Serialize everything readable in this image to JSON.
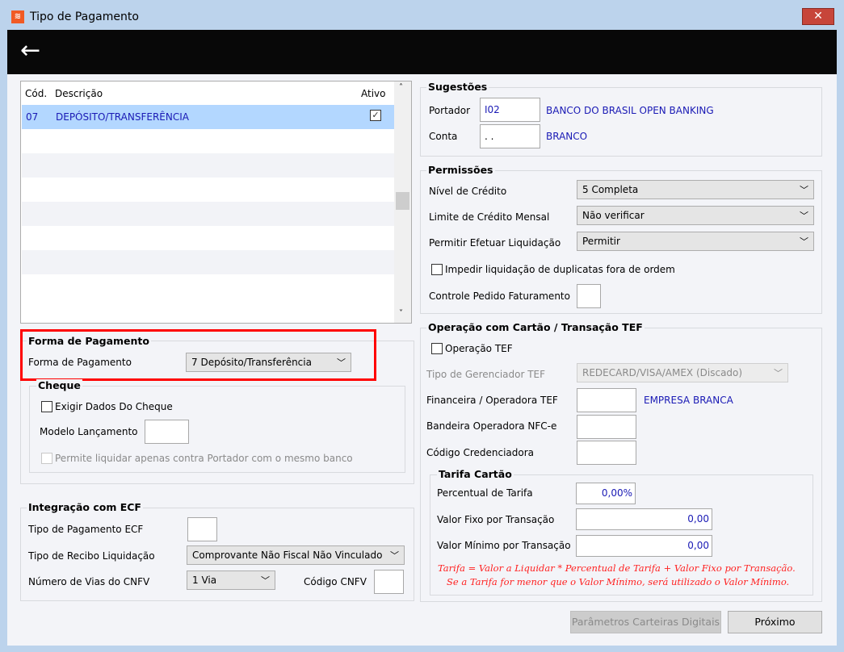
{
  "window": {
    "title": "Tipo de Pagamento",
    "close": "✕"
  },
  "grid": {
    "headers": [
      "Cód.",
      "Descrição",
      "Ativo"
    ],
    "rows": [
      {
        "cod": "07",
        "descricao": "DEPÓSITO/TRANSFERÊNCIA",
        "ativo": true
      }
    ]
  },
  "forma": {
    "group": "Forma de Pagamento",
    "label": "Forma de Pagamento",
    "value": "7 Depósito/Transferência"
  },
  "cheque": {
    "group": "Cheque",
    "exigir": "Exigir Dados Do Cheque",
    "modelo": "Modelo Lançamento",
    "permite": "Permite liquidar apenas contra Portador com o mesmo banco"
  },
  "ecf": {
    "group": "Integração com ECF",
    "tipo_pag": "Tipo de Pagamento ECF",
    "tipo_recibo": "Tipo de Recibo Liquidação",
    "tipo_recibo_value": "Comprovante Não Fiscal Não Vinculado",
    "vias": "Número de Vias do CNFV",
    "vias_value": "1 Via",
    "codigo": "Código CNFV"
  },
  "sugestoes": {
    "group": "Sugestões",
    "portador": "Portador",
    "portador_value": "I02",
    "portador_name": "BANCO DO BRASIL OPEN BANKING",
    "conta": "Conta",
    "conta_value": ". .",
    "conta_name": "BRANCO"
  },
  "permissoes": {
    "group": "Permissões",
    "nivel": "Nível de Crédito",
    "nivel_value": "5 Completa",
    "limite": "Limite de Crédito Mensal",
    "limite_value": "Não verificar",
    "permitir": "Permitir Efetuar Liquidação",
    "permitir_value": "Permitir",
    "impedir": "Impedir liquidação de duplicatas fora de ordem",
    "controle": "Controle Pedido Faturamento"
  },
  "tef": {
    "group": "Operação com Cartão / Transação TEF",
    "operacao": "Operação TEF",
    "tipo_ger": "Tipo de Gerenciador TEF",
    "tipo_ger_value": "REDECARD/VISA/AMEX (Discado)",
    "financeira": "Financeira / Operadora TEF",
    "financeira_name": "EMPRESA BRANCA",
    "bandeira": "Bandeira Operadora NFC-e",
    "codigo": "Código Credenciadora"
  },
  "tarifa": {
    "group": "Tarifa Cartão",
    "percentual": "Percentual de Tarifa",
    "percentual_value": "0,00%",
    "fixo": "Valor Fixo por Transação",
    "fixo_value": "0,00",
    "minimo": "Valor Mínimo por Transação",
    "minimo_value": "0,00",
    "note1": "Tarifa = Valor a Liquidar *  Percentual de Tarifa + Valor Fixo por Transação.",
    "note2": "Se a Tarifa for menor que o Valor Mínimo, será utilizado o Valor Mínimo."
  },
  "buttons": {
    "parametros": "Parâmetros Carteiras Digitais",
    "proximo": "Próximo"
  }
}
